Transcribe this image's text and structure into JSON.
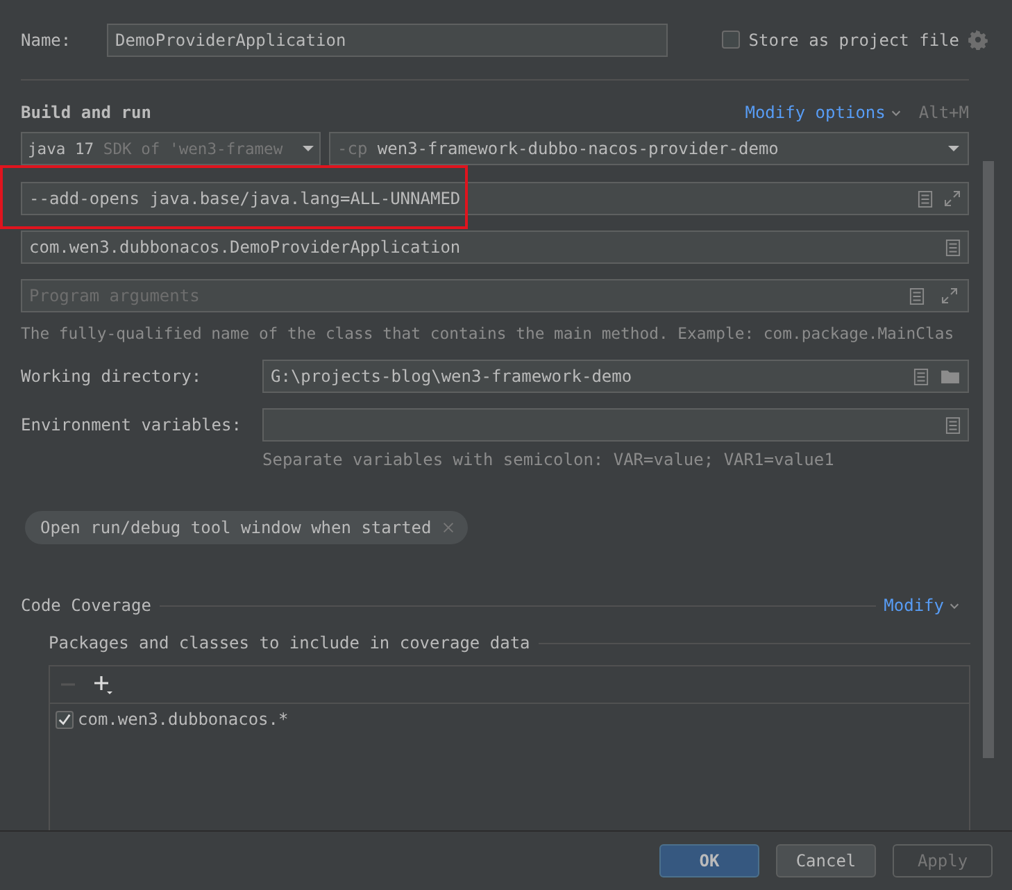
{
  "name_field": {
    "label": "Name:",
    "value": "DemoProviderApplication"
  },
  "store_as_project_file": {
    "label": "Store as project file",
    "checked": false
  },
  "build_and_run": {
    "title": "Build and run",
    "modify_link": "Modify options",
    "shortcut": "Alt+M",
    "jdk": {
      "value": "java 17",
      "detail": "SDK of 'wen3-framew"
    },
    "classpath": {
      "prefix": "-cp",
      "value": "wen3-framework-dubbo-nacos-provider-demo"
    },
    "vm_options": {
      "value": "--add-opens java.base/java.lang=ALL-UNNAMED",
      "highlighted": true
    },
    "main_class": {
      "value": "com.wen3.dubbonacos.DemoProviderApplication"
    },
    "program_arguments": {
      "placeholder": "Program arguments"
    },
    "hint": "The fully-qualified name of the class that contains the main method. Example: com.package.MainClas",
    "working_directory": {
      "label": "Working directory:",
      "value": "G:\\projects-blog\\wen3-framework-demo"
    },
    "environment_variables": {
      "label": "Environment variables:",
      "hint": "Separate variables with semicolon: VAR=value; VAR1=value1"
    },
    "chip": "Open run/debug tool window when started"
  },
  "code_coverage": {
    "title": "Code Coverage",
    "modify_link": "Modify",
    "packages_title": "Packages and classes to include in coverage data",
    "toolbar": [
      {
        "kind": "remove",
        "disabled": true
      },
      {
        "kind": "add",
        "disabled": false
      }
    ],
    "packages": [
      {
        "label": "com.wen3.dubbonacos.*",
        "checked": true
      }
    ]
  },
  "buttons": [
    {
      "label": "OK",
      "kind": "default",
      "disabled": false
    },
    {
      "label": "Cancel",
      "kind": "normal",
      "disabled": false
    },
    {
      "label": "Apply",
      "kind": "normal",
      "disabled": true
    }
  ]
}
